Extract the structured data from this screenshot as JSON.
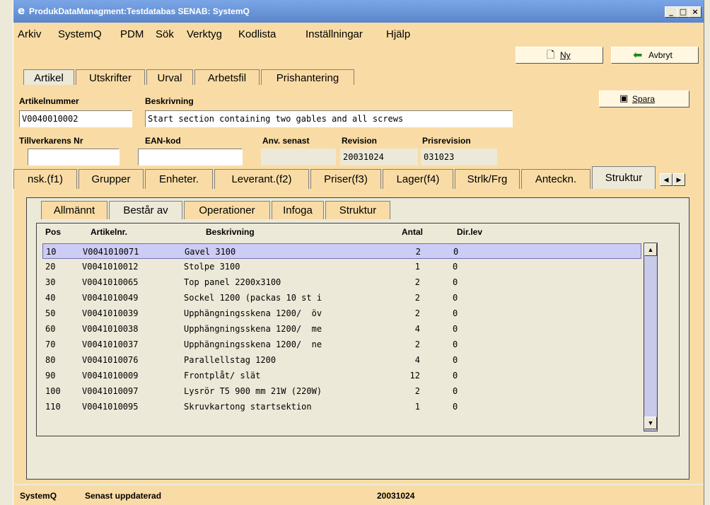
{
  "window": {
    "title": "ProdukDataManagment:Testdatabas SENAB: SystemQ",
    "app_icon": "e"
  },
  "menu": [
    "Arkiv",
    "SystemQ",
    "PDM",
    "Sök",
    "Verktyg",
    "Kodlista",
    "Inställningar",
    "Hjälp"
  ],
  "toolbar": {
    "new_label": "Ny",
    "cancel_label": "Avbryt"
  },
  "top_tabs": [
    "Artikel",
    "Utskrifter",
    "Urval",
    "Arbetsfil",
    "Prishantering"
  ],
  "form": {
    "artikelnummer_label": "Artikelnummer",
    "artikelnummer": "V0040010002",
    "beskrivning_label": "Beskrivning",
    "beskrivning": "Start section containing two gables and all screws",
    "save_label": "Spara",
    "tillverkarens_label": "Tillverkarens Nr",
    "tillverkarens": "",
    "ean_label": "EAN-kod",
    "ean": "",
    "anv_label": "Anv. senast",
    "anv": "",
    "revision_label": "Revision",
    "revision": "20031024",
    "prisrevision_label": "Prisrevision",
    "prisrevision": "031023"
  },
  "sub_tabs": [
    "nsk.(f1)",
    "Grupper",
    "Enheter.",
    "Leverant.(f2)",
    "Priser(f3)",
    "Lager(f4)",
    "Strlk/Frg",
    "Anteckn.",
    "Struktur"
  ],
  "struct_tabs": [
    "Allmännt",
    "Består av",
    "Operationer",
    "Infoga",
    "Struktur"
  ],
  "table": {
    "headers": [
      "Pos",
      "Artikelnr.",
      "Beskrivning",
      "Antal",
      "Dir.lev"
    ],
    "rows": [
      [
        "10",
        "V0041010071",
        "Gavel 3100",
        "2",
        "0"
      ],
      [
        "20",
        "V0041010012",
        "Stolpe 3100",
        "1",
        "0"
      ],
      [
        "30",
        "V0041010065",
        "Top panel 2200x3100",
        "2",
        "0"
      ],
      [
        "40",
        "V0041010049",
        "Sockel 1200 (packas 10 st i",
        "2",
        "0"
      ],
      [
        "50",
        "V0041010039",
        "Upphängningsskena 1200/  öv",
        "2",
        "0"
      ],
      [
        "60",
        "V0041010038",
        "Upphängningsskena 1200/  me",
        "4",
        "0"
      ],
      [
        "70",
        "V0041010037",
        "Upphängningsskena 1200/  ne",
        "2",
        "0"
      ],
      [
        "80",
        "V0041010076",
        "Parallellstag 1200",
        "4",
        "0"
      ],
      [
        "90",
        "V0041010009",
        "Frontplåt/ slät",
        "12",
        "0"
      ],
      [
        "100",
        "V0041010097",
        "Lysrör T5 900 mm 21W (220W)",
        "2",
        "0"
      ],
      [
        "110",
        "V0041010095",
        "Skruvkartong startsektion",
        "1",
        "0"
      ]
    ]
  },
  "status": {
    "app": "SystemQ",
    "label": "Senast uppdaterad",
    "date": "20031024"
  }
}
